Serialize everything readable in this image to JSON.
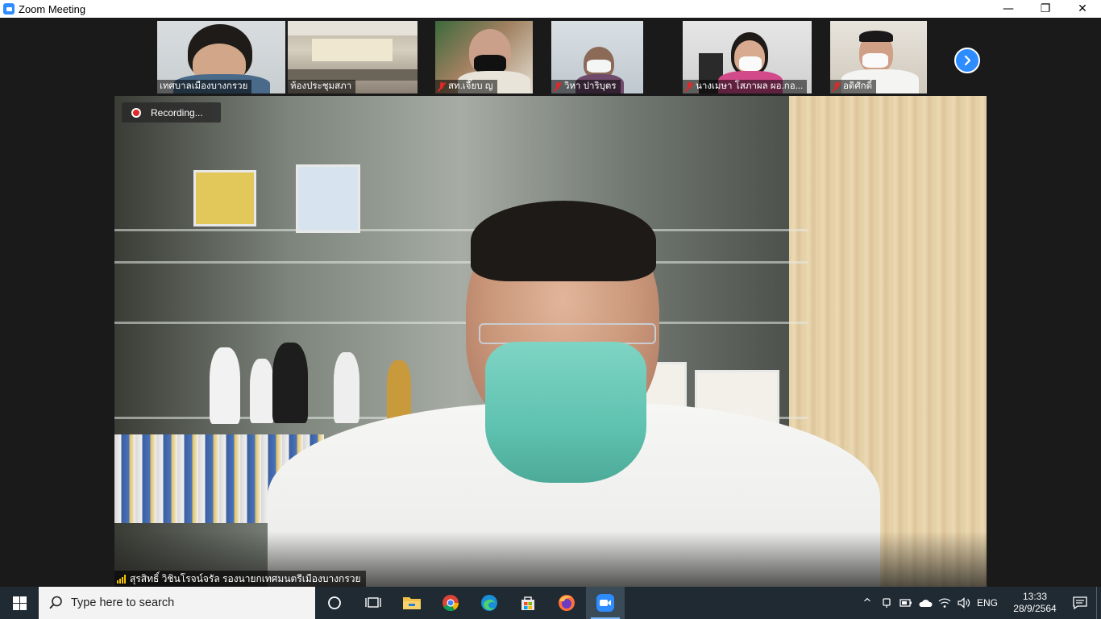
{
  "window": {
    "title": "Zoom Meeting",
    "minimize": "—",
    "restore": "❐",
    "close": "✕"
  },
  "recording": {
    "label": "Recording..."
  },
  "thumbnails": [
    {
      "name": "เทศบาลเมืองบางกรวย",
      "muted": false
    },
    {
      "name": "ห้องประชุมสภา",
      "muted": false
    },
    {
      "name": "สท.เจี๊ยบ ญ",
      "muted": true
    },
    {
      "name": "วิหา ปาริบุตร",
      "muted": true
    },
    {
      "name": "นางเมษา โสภาผล ผอ.กอ...",
      "muted": true
    },
    {
      "name": "อดิศักดิ์",
      "muted": true
    }
  ],
  "speaker": {
    "name": "สุรสิทธิ์ วิชินโรจน์จรัล รองนายกเทศมนตรีเมืองบางกรวย"
  },
  "taskbar": {
    "search_placeholder": "Type here to search",
    "apps": [
      "task-view",
      "file-explorer",
      "chrome",
      "edge",
      "microsoft-store",
      "firefox",
      "zoom"
    ],
    "language": "ENG",
    "time": "13:33",
    "date": "28/9/2564"
  },
  "colors": {
    "zoom_blue": "#2d8cff",
    "muted_red": "#e02828",
    "taskbar": "#1f2a33"
  }
}
